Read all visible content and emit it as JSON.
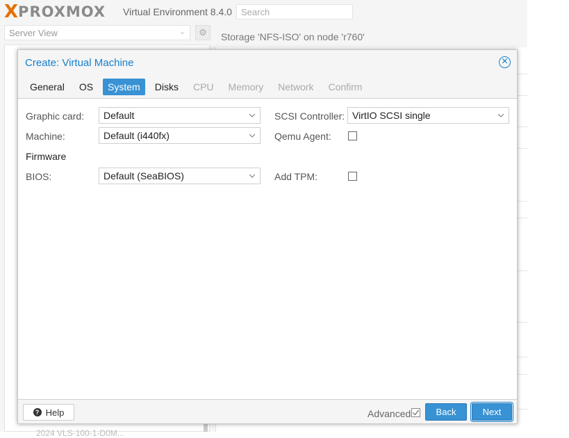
{
  "app": {
    "logo_x": "X",
    "logo_text": "PROXMOX",
    "version": "Virtual Environment 8.4.0",
    "search_placeholder": "Search",
    "server_view": "Server View",
    "content_title": "Storage 'NFS-ISO' on node 'r760'",
    "bottom_node_fragment": "2024 VLS-100-1-D0M..."
  },
  "dialog": {
    "title": "Create: Virtual Machine",
    "tabs": [
      {
        "label": "General",
        "state": "normal"
      },
      {
        "label": "OS",
        "state": "normal"
      },
      {
        "label": "System",
        "state": "active"
      },
      {
        "label": "Disks",
        "state": "normal"
      },
      {
        "label": "CPU",
        "state": "disabled"
      },
      {
        "label": "Memory",
        "state": "disabled"
      },
      {
        "label": "Network",
        "state": "disabled"
      },
      {
        "label": "Confirm",
        "state": "disabled"
      }
    ],
    "form": {
      "graphic_card_label": "Graphic card:",
      "graphic_card_value": "Default",
      "machine_label": "Machine:",
      "machine_value": "Default (i440fx)",
      "firmware_heading": "Firmware",
      "bios_label": "BIOS:",
      "bios_value": "Default (SeaBIOS)",
      "scsi_label": "SCSI Controller:",
      "scsi_value": "VirtIO SCSI single",
      "qemu_label": "Qemu Agent:",
      "qemu_checked": false,
      "tpm_label": "Add TPM:",
      "tpm_checked": false
    },
    "footer": {
      "help": "Help",
      "advanced": "Advanced",
      "advanced_checked": true,
      "back": "Back",
      "next": "Next"
    }
  },
  "colors": {
    "accent": "#157fcc",
    "active_tab": "#3892d4",
    "logo_orange": "#e57000"
  }
}
